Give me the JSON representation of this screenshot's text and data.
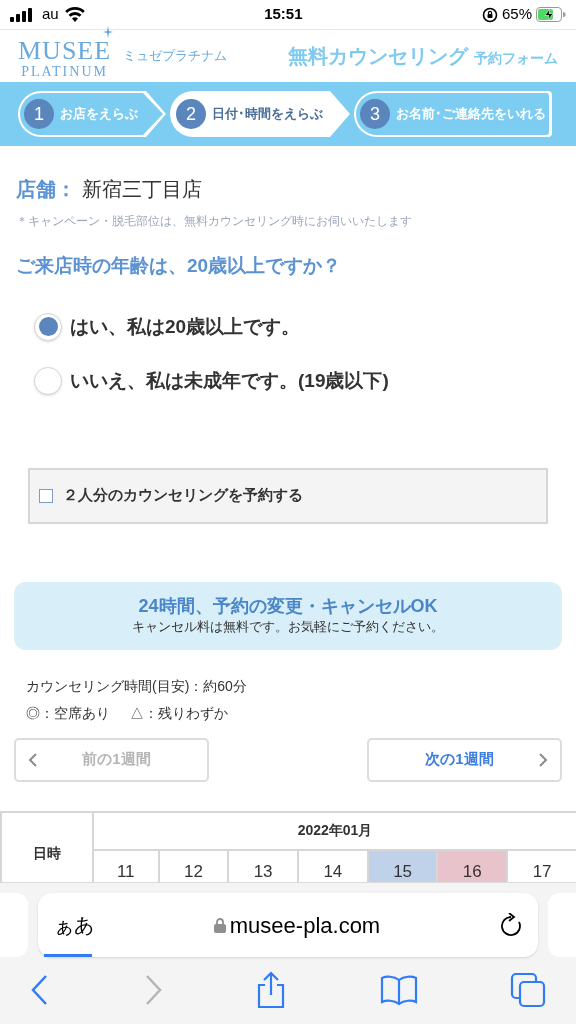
{
  "status_bar": {
    "carrier": "au",
    "time": "15:51",
    "battery": "65%"
  },
  "header": {
    "logo_top": "MUSEE",
    "logo_bottom": "PLATINUM",
    "logo_kana": "ミュゼプラチナム",
    "title": "無料カウンセリング",
    "subtitle": "予約フォーム"
  },
  "steps": [
    {
      "number": "1",
      "label": "お店をえらぶ",
      "selected": false
    },
    {
      "number": "2",
      "label": "日付･時間をえらぶ",
      "selected": true
    },
    {
      "number": "3",
      "label": "お名前･ご連絡先をいれる",
      "selected": false
    }
  ],
  "store": {
    "label": "店舗：",
    "value": "新宿三丁目店"
  },
  "note": "＊キャンペーン・脱毛部位は、無料カウンセリング時にお伺いいたします",
  "question": "ご来店時の年齢は、20歳以上ですか？",
  "age_options": [
    {
      "label": "はい、私は20歳以上です。",
      "selected": true
    },
    {
      "label": "いいえ、私は未成年です。(19歳以下)",
      "selected": false
    }
  ],
  "pair_option": {
    "label": "２人分のカウンセリングを予約する",
    "checked": false
  },
  "notice": {
    "title": "24時間、予約の変更・キャンセルOK",
    "text": "キャンセル料は無料です。お気軽にご予約ください。"
  },
  "duration": "カウンセリング時間(目安)：約60分",
  "legend": [
    "◎：空席あり",
    "△：残りわずか"
  ],
  "week_nav": {
    "prev": {
      "label": "前の1週間",
      "disabled": true
    },
    "next": {
      "label": "次の1週間",
      "disabled": false
    }
  },
  "calendar": {
    "corner": "日時",
    "month": "2022年01月",
    "days": [
      {
        "label": "11"
      },
      {
        "label": "12"
      },
      {
        "label": "13"
      },
      {
        "label": "14"
      },
      {
        "label": "15",
        "color": "#bfd2ea"
      },
      {
        "label": "16",
        "color": "#e9c3cc"
      },
      {
        "label": "17"
      }
    ]
  },
  "browser": {
    "text_size": "ぁあ",
    "url": "musee-pla.com",
    "back_disabled": false,
    "forward_disabled": true
  }
}
